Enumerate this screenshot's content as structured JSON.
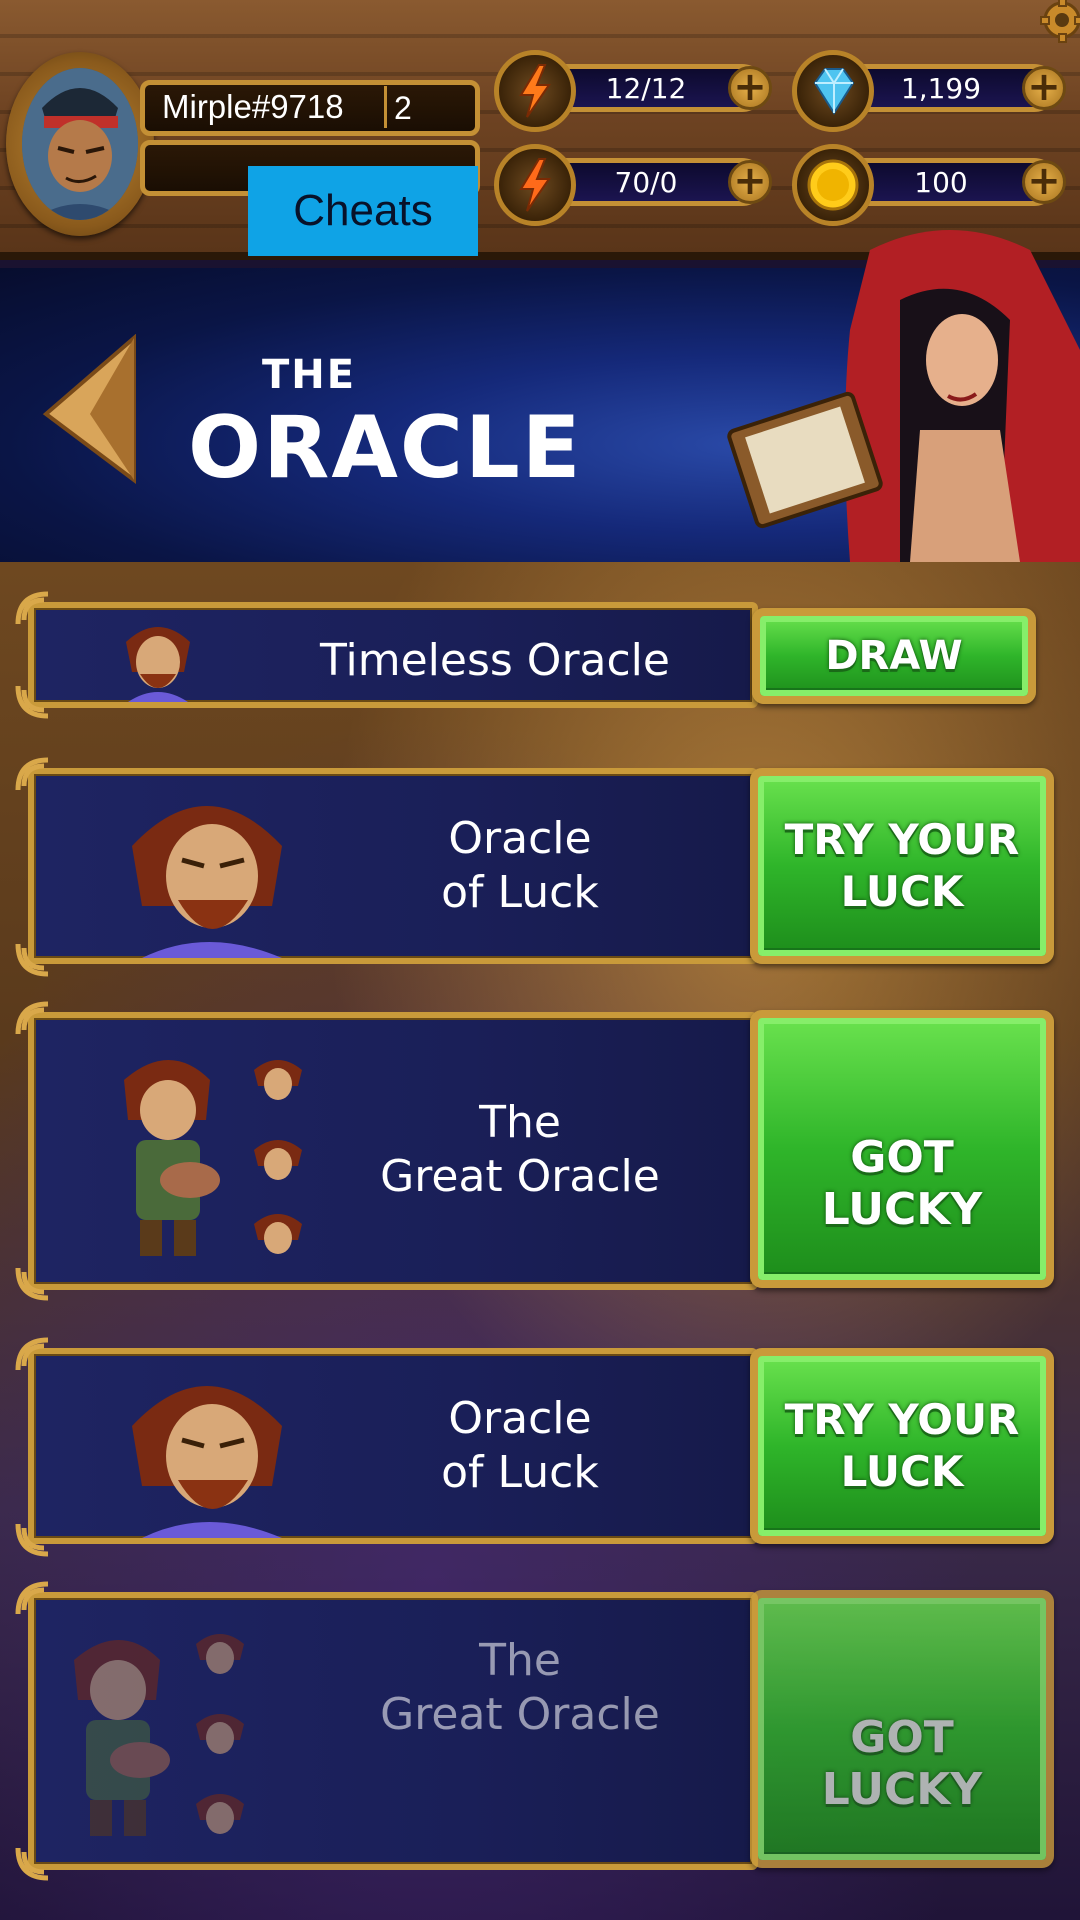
{
  "player": {
    "name": "Mirple#9718",
    "level": "2"
  },
  "cheats_label": "Cheats",
  "resources": [
    {
      "icon": "energy-bolt-icon",
      "value": "12/12"
    },
    {
      "icon": "blue-gem-icon",
      "value": "1,199"
    },
    {
      "icon": "energy-bolt-icon",
      "value": "70/0"
    },
    {
      "icon": "gold-coin-icon",
      "value": "100"
    }
  ],
  "header": {
    "title_small": "THE",
    "title_large": "ORACLE"
  },
  "rows": [
    {
      "title_line1": "Timeless Oracle",
      "title_line2": "",
      "button": "DRAW"
    },
    {
      "title_line1": "Oracle",
      "title_line2": "of Luck",
      "button_line1": "TRY YOUR",
      "button_line2": "LUCK"
    },
    {
      "title_line1": "The",
      "title_line2": "Great Oracle",
      "button_line1": "GOT",
      "button_line2": "LUCKY"
    },
    {
      "title_line1": "Oracle",
      "title_line2": "of Luck",
      "button_line1": "TRY YOUR",
      "button_line2": "LUCK"
    },
    {
      "title_line1": "The",
      "title_line2": "Great Oracle",
      "button_line1": "GOT",
      "button_line2": "LUCKY"
    }
  ],
  "colors": {
    "gold": "#c99a3a",
    "panel": "#1e2462",
    "button_green": "#2fb52a",
    "cheats_blue": "#0fa3e6"
  }
}
